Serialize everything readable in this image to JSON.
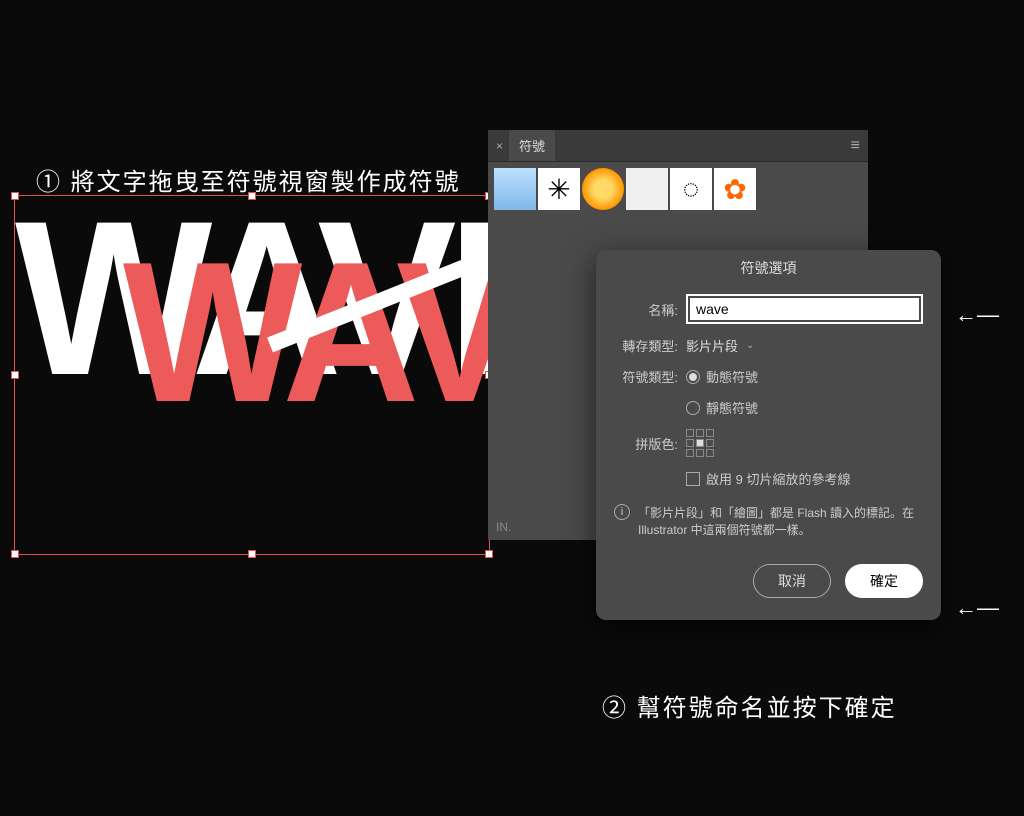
{
  "annotations": {
    "step1": "① 將文字拖曳至符號視窗製作成符號",
    "step2": "② 幫符號命名並按下確定"
  },
  "canvas": {
    "text_white": "WAVE",
    "text_red": "WAVE"
  },
  "symbols_panel": {
    "title": "符號",
    "close": "×",
    "menu": "≡",
    "footer": "IN.",
    "items": [
      "gradient",
      "ink",
      "sphere",
      "box",
      "ring",
      "flower"
    ]
  },
  "dialog": {
    "title": "符號選項",
    "name_label": "名稱:",
    "name_value": "wave",
    "export_label": "轉存類型:",
    "export_value": "影片片段",
    "type_label": "符號類型:",
    "type_dynamic": "動態符號",
    "type_static": "靜態符號",
    "registration_label": "拼版色:",
    "slice_label": "啟用 9 切片縮放的參考線",
    "info_text": "「影片片段」和「繪圖」都是 Flash 讀入的標記。在 Illustrator 中這兩個符號都一樣。",
    "cancel": "取消",
    "ok": "確定"
  }
}
